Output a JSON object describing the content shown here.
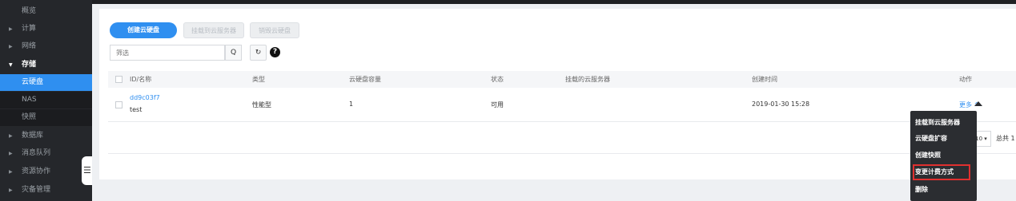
{
  "sidebar": {
    "items": [
      {
        "label": "概览"
      },
      {
        "label": "计算"
      },
      {
        "label": "网络"
      },
      {
        "label": "存储"
      },
      {
        "label": "云硬盘"
      },
      {
        "label": "NAS"
      },
      {
        "label": "快照"
      },
      {
        "label": "数据库"
      },
      {
        "label": "消息队列"
      },
      {
        "label": "资源协作"
      },
      {
        "label": "灾备管理"
      }
    ],
    "collapse_icon": "menu-collapse-icon"
  },
  "toolbar": {
    "create_label": "创建云硬盘",
    "attach_label": "挂载到云服务器",
    "destroy_label": "销毁云硬盘",
    "filter_placeholder": "筛选",
    "search_icon": "Q",
    "refresh_icon": "↻",
    "help_icon": "?"
  },
  "table": {
    "headers": [
      "ID/名称",
      "类型",
      "云硬盘容量",
      "状态",
      "挂载的云服务器",
      "创建时间",
      "动作"
    ],
    "rows": [
      {
        "id": "dd9c03f7",
        "name": "test",
        "type": "性能型",
        "capacity": "1",
        "status": "可用",
        "server": "",
        "created": "2019-01-30 15:28",
        "action": "更多 ^"
      }
    ]
  },
  "pager": {
    "page_size": "10",
    "total": "总共 1"
  },
  "dropdown": {
    "items": [
      "挂载到云服务器",
      "云硬盘扩容",
      "创建快照",
      "变更计费方式",
      "删除"
    ]
  },
  "colors": {
    "accent": "#2f8ff0",
    "sidebar_bg": "#25272b",
    "highlight_border": "#e0302f"
  }
}
